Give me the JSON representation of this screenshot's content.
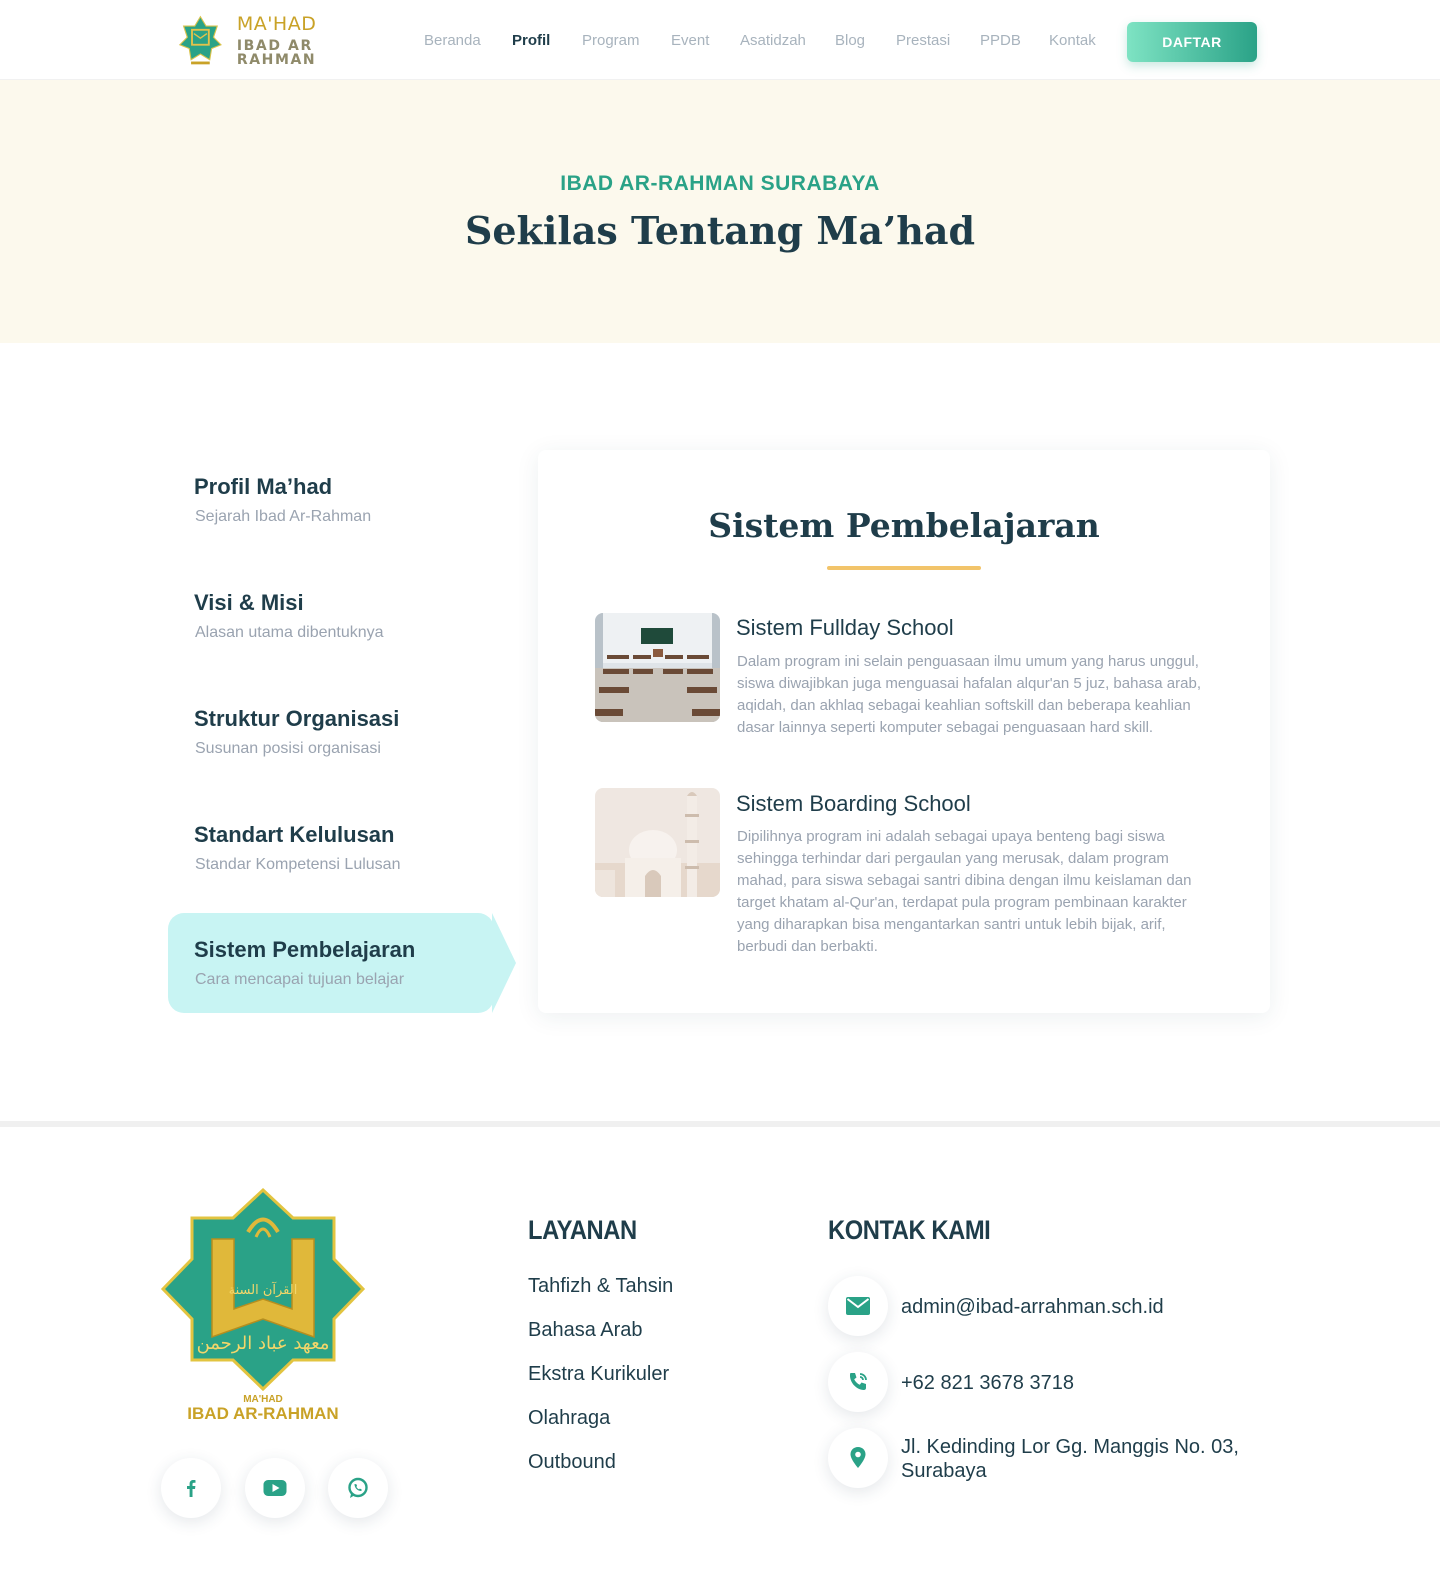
{
  "brand": {
    "line1": "MA'HAD",
    "line2": "IBAD AR RAHMAN"
  },
  "nav": {
    "links": [
      "Beranda",
      "Profil",
      "Program",
      "Event",
      "Asatidzah",
      "Blog",
      "Prestasi",
      "PPDB",
      "Kontak"
    ],
    "active": "Profil",
    "cta": "DAFTAR"
  },
  "hero": {
    "eyebrow": "IBAD AR-RAHMAN SURABAYA",
    "title": "Sekilas Tentang Ma’had"
  },
  "sidebar": {
    "items": [
      {
        "title": "Profil Ma’had",
        "subtitle": "Sejarah Ibad Ar-Rahman"
      },
      {
        "title": "Visi & Misi",
        "subtitle": "Alasan utama dibentuknya"
      },
      {
        "title": "Struktur Organisasi",
        "subtitle": "Susunan posisi organisasi"
      },
      {
        "title": "Standart Kelulusan",
        "subtitle": "Standar Kompetensi Lulusan"
      },
      {
        "title": "Sistem Pembelajaran",
        "subtitle": "Cara mencapai tujuan belajar"
      }
    ],
    "active_index": 4
  },
  "content": {
    "title": "Sistem Pembelajaran",
    "features": [
      {
        "title": "Sistem Fullday School",
        "description": "Dalam program ini selain penguasaan ilmu umum yang harus unggul, siswa diwajibkan juga menguasai hafalan alqur'an 5 juz, bahasa arab, aqidah, dan akhlaq sebagai keahlian softskill dan beberapa keahlian dasar lainnya seperti komputer sebagai penguasaan hard skill.",
        "image": "classroom-photo"
      },
      {
        "title": "Sistem Boarding School",
        "description": "Dipilihnya program ini adalah sebagai upaya benteng bagi siswa sehingga terhindar dari pergaulan yang merusak, dalam program mahad, para siswa sebagai santri dibina dengan ilmu keislaman dan target khatam al-Qur'an, terdapat pula program pembinaan karakter yang diharapkan bisa mengantarkan santri untuk lebih bijak, arif, berbudi dan berbakti.",
        "image": "mosque-photo"
      }
    ]
  },
  "footer": {
    "logo": {
      "arabic_top": "القرآن السنة",
      "arabic_bottom": "معهد عباد الرحمن",
      "line1": "MA'HAD",
      "line2": "IBAD AR-RAHMAN"
    },
    "social_icons": [
      "facebook-icon",
      "youtube-icon",
      "whatsapp-icon"
    ],
    "layanan": {
      "heading": "LAYANAN",
      "links": [
        "Tahfizh & Tahsin",
        "Bahasa Arab",
        "Ekstra Kurikuler",
        "Olahraga",
        "Outbound"
      ]
    },
    "kontak": {
      "heading": "KONTAK KAMI",
      "email": "admin@ibad-arrahman.sch.id",
      "phone": "+62 821 3678 3718",
      "address_line1": "Jl. Kedinding Lor Gg. Manggis No. 03,",
      "address_line2": "Surabaya"
    }
  },
  "colors": {
    "primary": "#2aa287",
    "dark": "#1f3d4a",
    "gold": "#c9a227",
    "muted": "#9aa3b0",
    "hero_bg": "#fcf9ed",
    "active_bg": "#c8f4f3",
    "accent_line": "#f2c46a"
  }
}
